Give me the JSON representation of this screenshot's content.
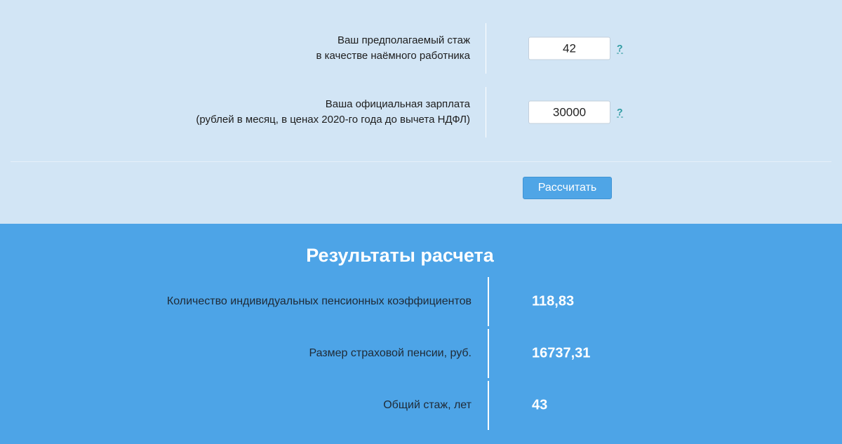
{
  "form": {
    "experience": {
      "label_line1": "Ваш предполагаемый стаж",
      "label_line2": "в качестве наёмного работника",
      "value": "42",
      "help": "?"
    },
    "salary": {
      "label_line1": "Ваша официальная зарплата",
      "label_line2": "(рублей в месяц, в ценах 2020-го года до вычета НДФЛ)",
      "value": "30000",
      "help": "?"
    },
    "calculate_label": "Рассчитать"
  },
  "results": {
    "title": "Результаты расчета",
    "rows": [
      {
        "label": "Количество индивидуальных пенсионных коэффициентов",
        "value": "118,83"
      },
      {
        "label": "Размер страховой пенсии, руб.",
        "value": "16737,31"
      },
      {
        "label": "Общий стаж, лет",
        "value": "43"
      }
    ]
  },
  "colors": {
    "form_bg": "#d2e5f5",
    "results_bg": "#4da4e7",
    "button_bg": "#4fa5e6",
    "help_link": "#2c9aa0"
  }
}
